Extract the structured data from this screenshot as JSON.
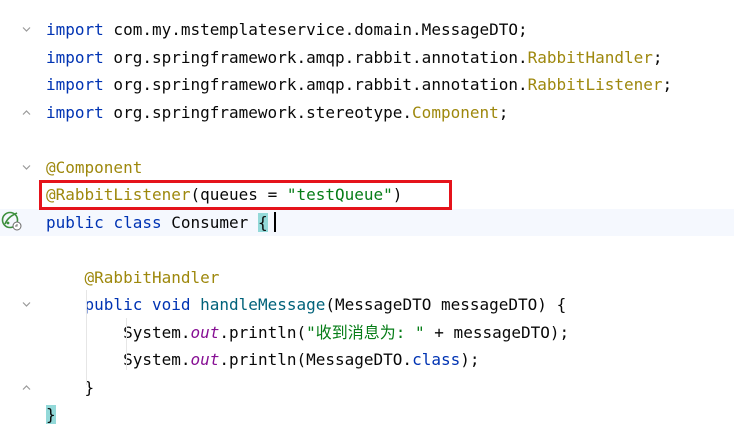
{
  "editor": {
    "lines": [
      {
        "tokens": [
          {
            "t": "import",
            "c": "kw"
          },
          {
            "t": " com.my.mstemplateservice.domain.MessageDTO;",
            "c": "plain"
          }
        ],
        "fold": "open"
      },
      {
        "tokens": [
          {
            "t": "import",
            "c": "kw"
          },
          {
            "t": " org.springframework.amqp.rabbit.annotation.",
            "c": "plain"
          },
          {
            "t": "RabbitHandler",
            "c": "cls"
          },
          {
            "t": ";",
            "c": "plain"
          }
        ]
      },
      {
        "tokens": [
          {
            "t": "import",
            "c": "kw"
          },
          {
            "t": " org.springframework.amqp.rabbit.annotation.",
            "c": "plain"
          },
          {
            "t": "RabbitListener",
            "c": "cls"
          },
          {
            "t": ";",
            "c": "plain"
          }
        ]
      },
      {
        "tokens": [
          {
            "t": "import",
            "c": "kw"
          },
          {
            "t": " org.springframework.stereotype.",
            "c": "plain"
          },
          {
            "t": "Component",
            "c": "cls"
          },
          {
            "t": ";",
            "c": "plain"
          }
        ],
        "fold": "close"
      },
      {
        "tokens": []
      },
      {
        "tokens": [
          {
            "t": "@Component",
            "c": "ann"
          }
        ],
        "fold": "open"
      },
      {
        "tokens": [
          {
            "t": "@RabbitListener",
            "c": "ann"
          },
          {
            "t": "(queues = ",
            "c": "plain"
          },
          {
            "t": "\"testQueue\"",
            "c": "str"
          },
          {
            "t": ")",
            "c": "plain"
          }
        ]
      },
      {
        "tokens": [
          {
            "t": "public",
            "c": "kw"
          },
          {
            "t": " ",
            "c": "plain"
          },
          {
            "t": "class",
            "c": "kw"
          },
          {
            "t": " Consumer ",
            "c": "plain"
          },
          {
            "t": "{",
            "c": "brace"
          }
        ],
        "current": true
      },
      {
        "tokens": []
      },
      {
        "tokens": [
          {
            "t": "    ",
            "c": "plain"
          },
          {
            "t": "@RabbitHandler",
            "c": "ann"
          }
        ]
      },
      {
        "tokens": [
          {
            "t": "    ",
            "c": "plain"
          },
          {
            "t": "public",
            "c": "kw"
          },
          {
            "t": " ",
            "c": "plain"
          },
          {
            "t": "void",
            "c": "kw"
          },
          {
            "t": " ",
            "c": "plain"
          },
          {
            "t": "handleMessage",
            "c": "mth"
          },
          {
            "t": "(MessageDTO messageDTO) {",
            "c": "plain"
          }
        ],
        "fold": "open"
      },
      {
        "tokens": [
          {
            "t": "        System.",
            "c": "plain"
          },
          {
            "t": "out",
            "c": "fld"
          },
          {
            "t": ".println(",
            "c": "plain"
          },
          {
            "t": "\"收到消息为: \"",
            "c": "str"
          },
          {
            "t": " + messageDTO);",
            "c": "plain"
          }
        ]
      },
      {
        "tokens": [
          {
            "t": "        System.",
            "c": "plain"
          },
          {
            "t": "out",
            "c": "fld"
          },
          {
            "t": ".println(MessageDTO.",
            "c": "plain"
          },
          {
            "t": "class",
            "c": "kw"
          },
          {
            "t": ");",
            "c": "plain"
          }
        ]
      },
      {
        "tokens": [
          {
            "t": "    }",
            "c": "plain"
          }
        ],
        "fold": "close"
      },
      {
        "tokens": [
          {
            "t": "}",
            "c": "brace"
          }
        ]
      }
    ]
  },
  "colors": {
    "keyword": "#0033b3",
    "annotation": "#9e880d",
    "string": "#067d17",
    "field": "#871094",
    "method": "#00627a",
    "highlight_box": "#e5131b",
    "brace_match": "#93d9d9"
  },
  "gutter": {
    "bean_icon": "spring-bean-icon"
  }
}
